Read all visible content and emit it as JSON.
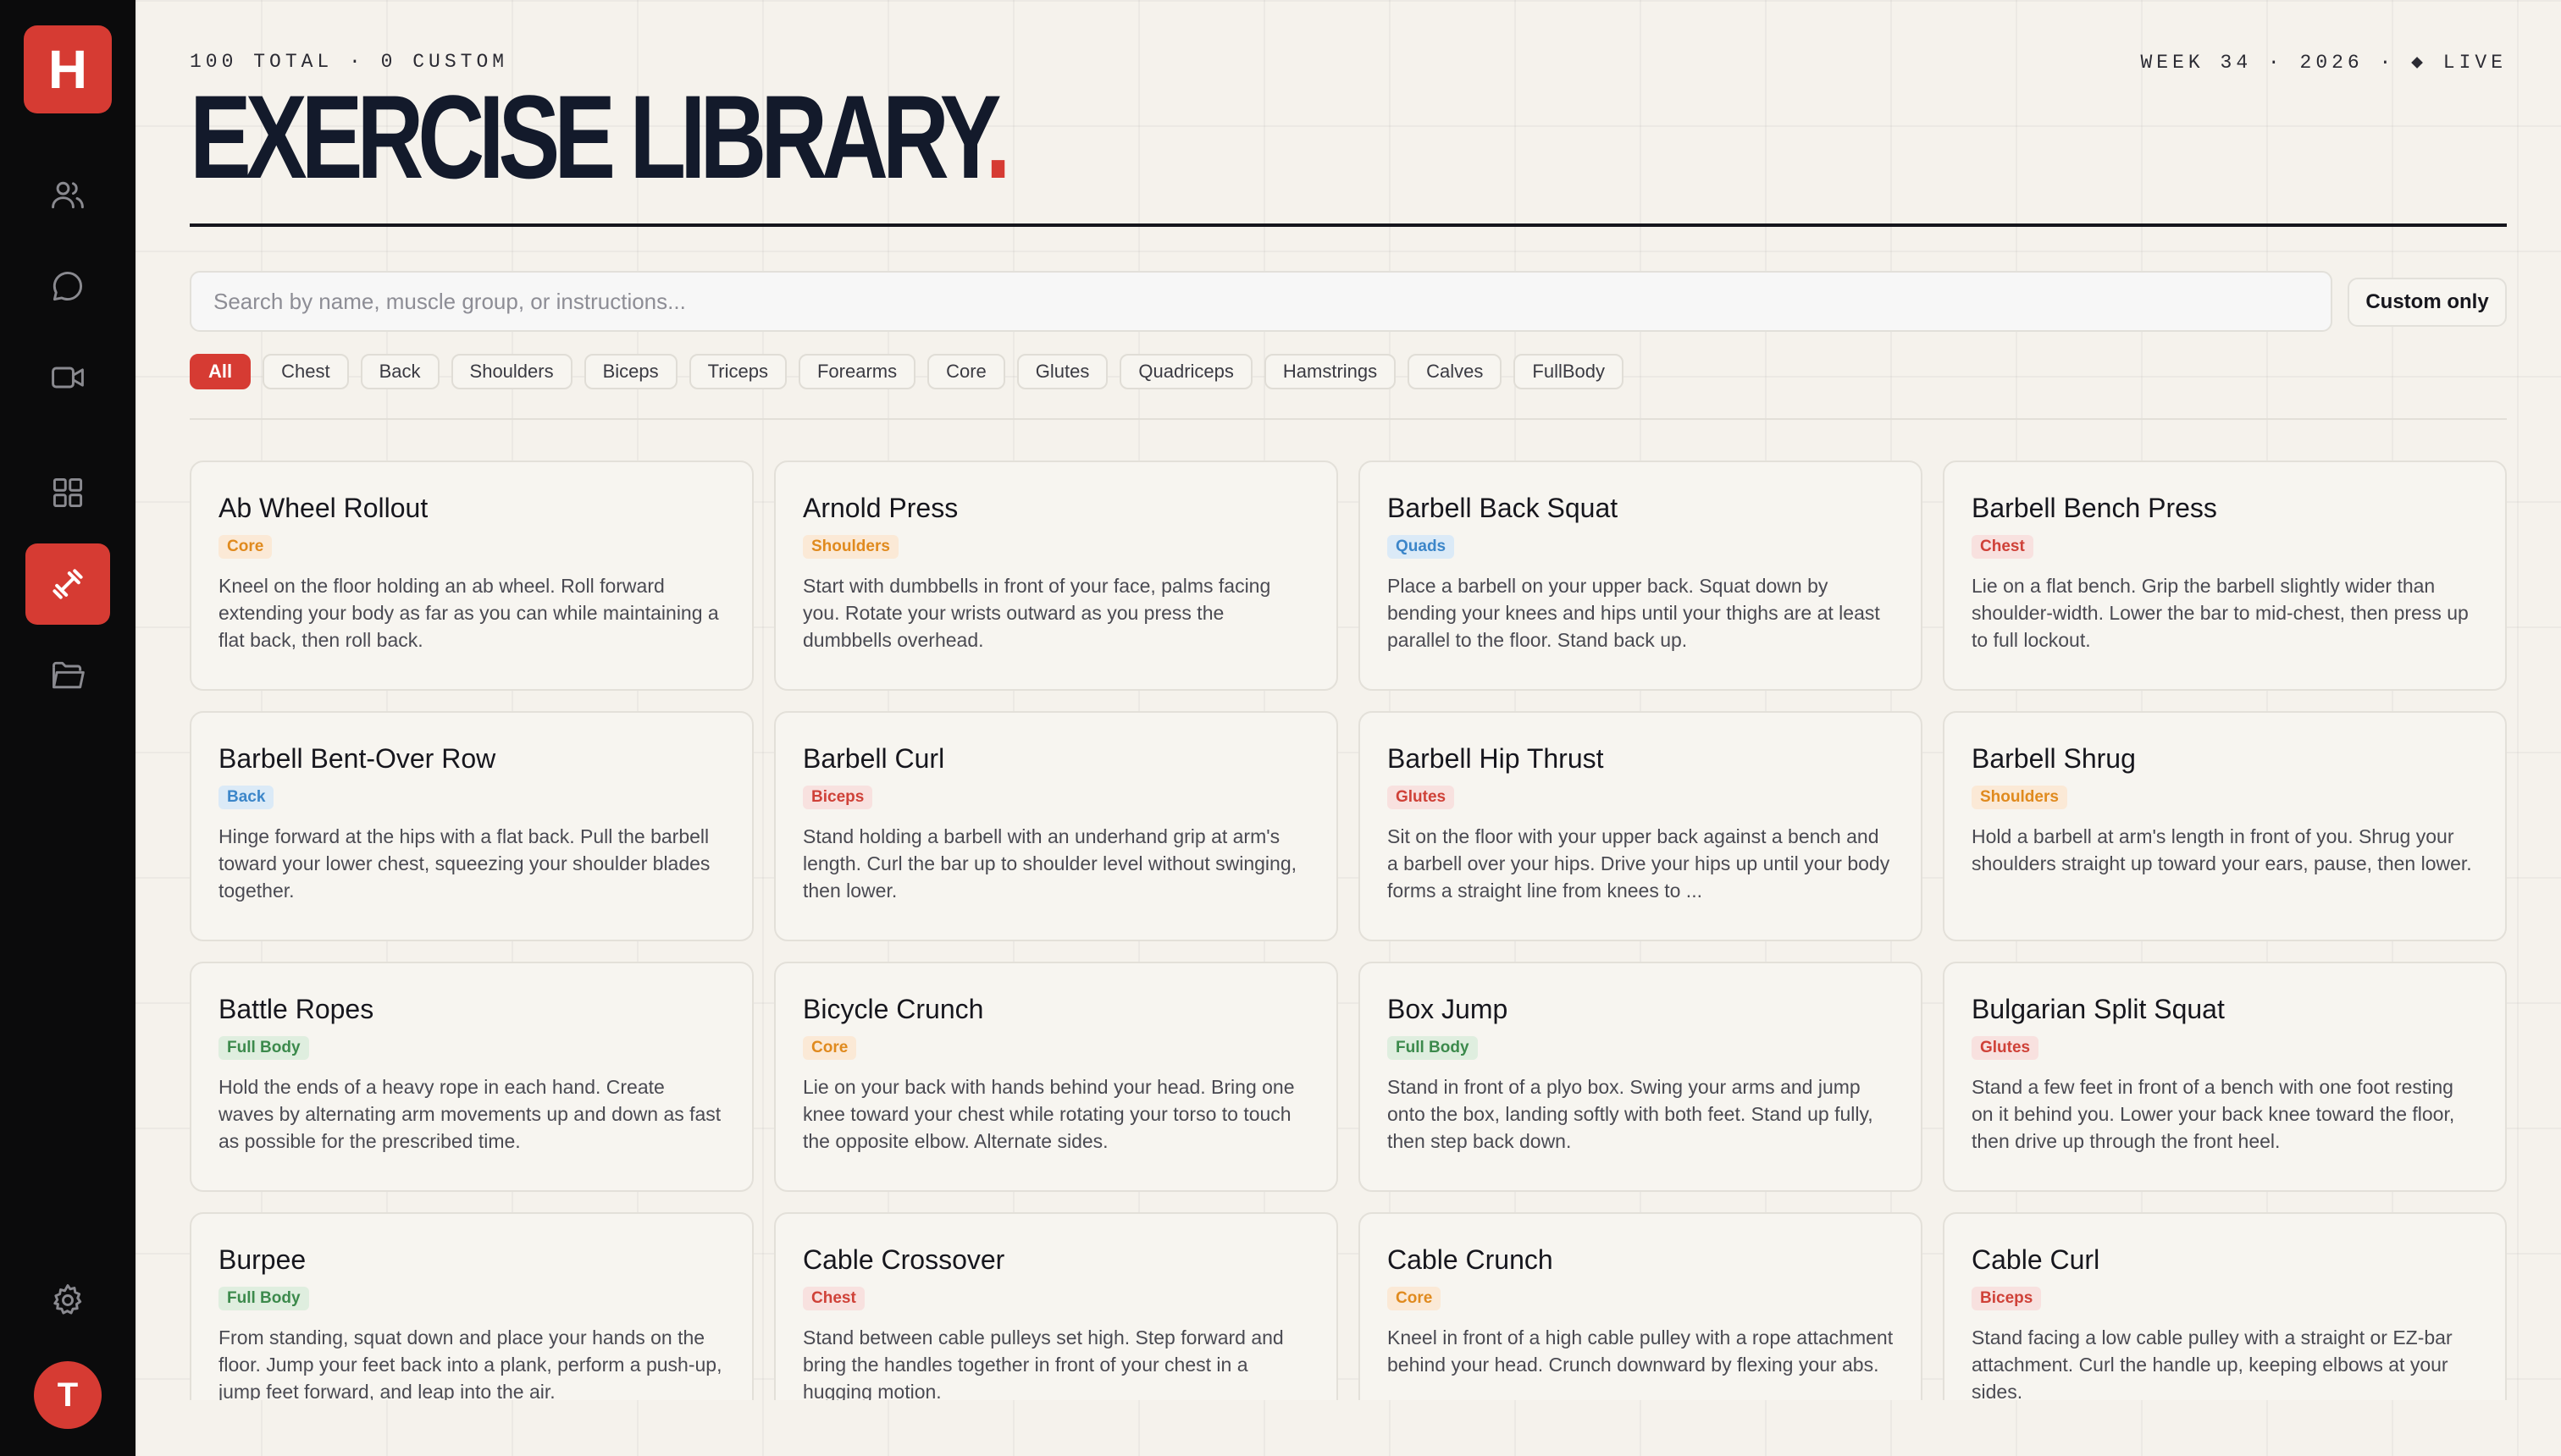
{
  "app": {
    "logo_letter": "H",
    "avatar_letter": "T"
  },
  "sidebar": {
    "items": [
      {
        "name": "users-icon"
      },
      {
        "name": "chat-icon"
      },
      {
        "name": "video-icon"
      },
      {
        "name": "grid-icon"
      },
      {
        "name": "dumbbell-icon",
        "active": true
      },
      {
        "name": "folder-icon"
      },
      {
        "name": "gear-icon"
      }
    ]
  },
  "header": {
    "meta_left": "100 TOTAL · 0 CUSTOM",
    "meta_right": "WEEK 34 · 2026 · ◆ LIVE",
    "title": "EXERCISE LIBRARY",
    "title_dot": "."
  },
  "search": {
    "placeholder": "Search by name, muscle group, or instructions...",
    "value": ""
  },
  "custom_only_label": "Custom only",
  "filters": [
    "All",
    "Chest",
    "Back",
    "Shoulders",
    "Biceps",
    "Triceps",
    "Forearms",
    "Core",
    "Glutes",
    "Quadriceps",
    "Hamstrings",
    "Calves",
    "FullBody"
  ],
  "active_filter": "All",
  "colors": {
    "accent": "#d63b33",
    "tag_orange": "#e08a1e",
    "tag_blue": "#3c86c9",
    "tag_red": "#cf4138",
    "tag_green": "#3c8a4c"
  },
  "exercises": [
    {
      "name": "Ab Wheel Rollout",
      "tag": "Core",
      "tag_color": "orange",
      "desc": "Kneel on the floor holding an ab wheel. Roll forward extending your body as far as you can while maintaining a flat back, then roll back."
    },
    {
      "name": "Arnold Press",
      "tag": "Shoulders",
      "tag_color": "orange",
      "desc": "Start with dumbbells in front of your face, palms facing you. Rotate your wrists outward as you press the dumbbells overhead."
    },
    {
      "name": "Barbell Back Squat",
      "tag": "Quads",
      "tag_color": "blue",
      "desc": "Place a barbell on your upper back. Squat down by bending your knees and hips until your thighs are at least parallel to the floor. Stand back up."
    },
    {
      "name": "Barbell Bench Press",
      "tag": "Chest",
      "tag_color": "red",
      "desc": "Lie on a flat bench. Grip the barbell slightly wider than shoulder-width. Lower the bar to mid-chest, then press up to full lockout."
    },
    {
      "name": "Barbell Bent-Over Row",
      "tag": "Back",
      "tag_color": "blue",
      "desc": "Hinge forward at the hips with a flat back. Pull the barbell toward your lower chest, squeezing your shoulder blades together."
    },
    {
      "name": "Barbell Curl",
      "tag": "Biceps",
      "tag_color": "red",
      "desc": "Stand holding a barbell with an underhand grip at arm's length. Curl the bar up to shoulder level without swinging, then lower."
    },
    {
      "name": "Barbell Hip Thrust",
      "tag": "Glutes",
      "tag_color": "red",
      "desc": "Sit on the floor with your upper back against a bench and a barbell over your hips. Drive your hips up until your body forms a straight line from knees to ..."
    },
    {
      "name": "Barbell Shrug",
      "tag": "Shoulders",
      "tag_color": "orange",
      "desc": "Hold a barbell at arm's length in front of you. Shrug your shoulders straight up toward your ears, pause, then lower."
    },
    {
      "name": "Battle Ropes",
      "tag": "Full Body",
      "tag_color": "green",
      "desc": "Hold the ends of a heavy rope in each hand. Create waves by alternating arm movements up and down as fast as possible for the prescribed time."
    },
    {
      "name": "Bicycle Crunch",
      "tag": "Core",
      "tag_color": "orange",
      "desc": "Lie on your back with hands behind your head. Bring one knee toward your chest while rotating your torso to touch the opposite elbow. Alternate sides."
    },
    {
      "name": "Box Jump",
      "tag": "Full Body",
      "tag_color": "green",
      "desc": "Stand in front of a plyo box. Swing your arms and jump onto the box, landing softly with both feet. Stand up fully, then step back down."
    },
    {
      "name": "Bulgarian Split Squat",
      "tag": "Glutes",
      "tag_color": "red",
      "desc": "Stand a few feet in front of a bench with one foot resting on it behind you. Lower your back knee toward the floor, then drive up through the front heel."
    },
    {
      "name": "Burpee",
      "tag": "Full Body",
      "tag_color": "green",
      "desc": "From standing, squat down and place your hands on the floor. Jump your feet back into a plank, perform a push-up, jump feet forward, and leap into the air."
    },
    {
      "name": "Cable Crossover",
      "tag": "Chest",
      "tag_color": "red",
      "desc": "Stand between cable pulleys set high. Step forward and bring the handles together in front of your chest in a hugging motion."
    },
    {
      "name": "Cable Crunch",
      "tag": "Core",
      "tag_color": "orange",
      "desc": "Kneel in front of a high cable pulley with a rope attachment behind your head. Crunch downward by flexing your abs."
    },
    {
      "name": "Cable Curl",
      "tag": "Biceps",
      "tag_color": "red",
      "desc": "Stand facing a low cable pulley with a straight or EZ-bar attachment. Curl the handle up, keeping elbows at your sides."
    }
  ]
}
